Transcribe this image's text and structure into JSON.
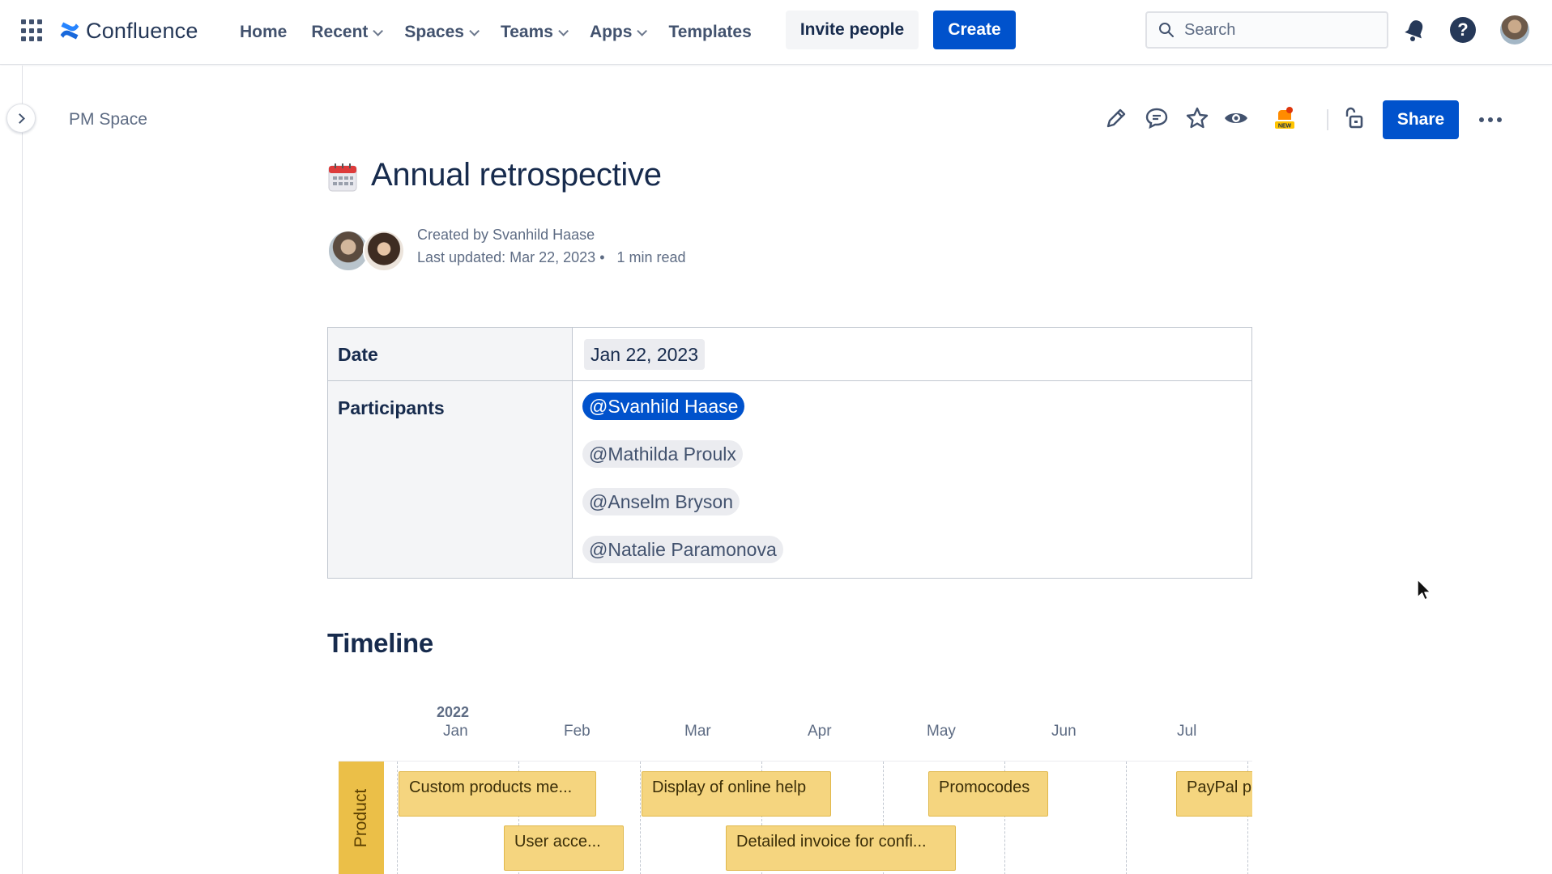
{
  "topnav": {
    "app_name": "Confluence",
    "links": [
      {
        "label": "Home",
        "dropdown": false
      },
      {
        "label": "Recent",
        "dropdown": true
      },
      {
        "label": "Spaces",
        "dropdown": true
      },
      {
        "label": "Teams",
        "dropdown": true
      },
      {
        "label": "Apps",
        "dropdown": true
      },
      {
        "label": "Templates",
        "dropdown": false
      }
    ],
    "invite_label": "Invite people",
    "create_label": "Create",
    "search_placeholder": "Search",
    "help_glyph": "?"
  },
  "breadcrumb": "PM Space",
  "toolbar": {
    "icons": [
      "edit-icon",
      "comment-icon",
      "star-icon",
      "watch-icon",
      "new-feature-icon",
      "restrictions-icon"
    ],
    "share_label": "Share"
  },
  "page": {
    "title": "Annual retrospective",
    "created_by": "Created by Svanhild Haase",
    "last_updated": "Last updated: Mar 22, 2023",
    "read_time": "1 min read"
  },
  "info_table": {
    "date_label": "Date",
    "date_value": "Jan 22, 2023",
    "participants_label": "Participants",
    "participants": [
      {
        "name": "@Svanhild Haase",
        "is_self": true
      },
      {
        "name": "@Mathilda Proulx",
        "is_self": false
      },
      {
        "name": "@Anselm Bryson",
        "is_self": false
      },
      {
        "name": "@Natalie Paramonova",
        "is_self": false
      }
    ]
  },
  "timeline": {
    "heading": "Timeline",
    "year": "2022",
    "months": [
      "Jan",
      "Feb",
      "Mar",
      "Apr",
      "May",
      "Jun",
      "Jul"
    ],
    "lane": "Product",
    "items": [
      "Custom products me...",
      "User acce...",
      "Display of online help",
      "Detailed invoice for confi...",
      "Promocodes",
      "PayPal p"
    ]
  },
  "colors": {
    "brand_blue": "#0052cc",
    "text": "#172b4d",
    "subtle_text": "#5e6c84",
    "lane_color": "#ebbf48",
    "bar_color": "#f5d57f"
  }
}
